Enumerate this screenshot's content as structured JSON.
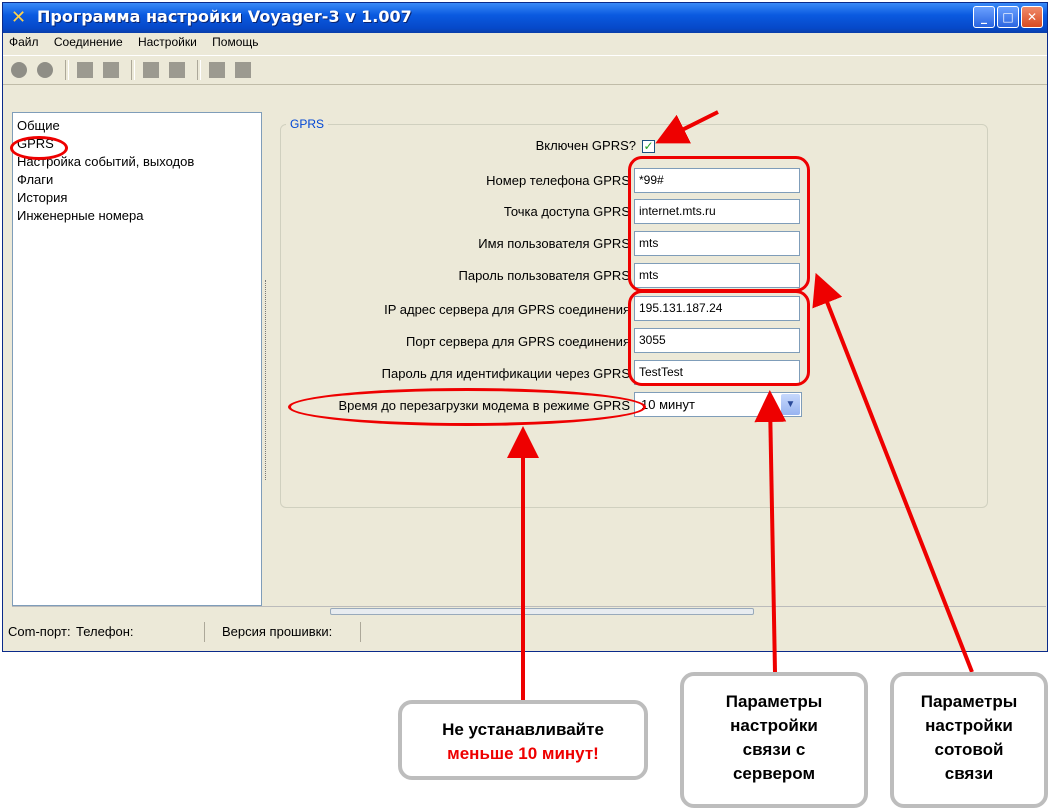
{
  "window": {
    "title": "Программа настройки Voyager-3 v 1.007",
    "app_icon": "tools-icon"
  },
  "menu": {
    "items": [
      "Файл",
      "Соединение",
      "Настройки",
      "Помощь"
    ]
  },
  "nav": {
    "items": [
      {
        "label": "Общие"
      },
      {
        "label": "GPRS",
        "selected": true
      },
      {
        "label": "Настройка событий, выходов"
      },
      {
        "label": "Флаги"
      },
      {
        "label": "История"
      },
      {
        "label": "Инженерные номера"
      }
    ]
  },
  "gprs": {
    "legend": "GPRS",
    "enabled_label": "Включен GPRS?",
    "enabled_checked": true,
    "phone_label": "Номер телефона GPRS",
    "phone_value": "*99#",
    "apn_label": "Точка доступа GPRS",
    "apn_value": "internet.mts.ru",
    "user_label": "Имя пользователя GPRS",
    "user_value": "mts",
    "pass_label": "Пароль пользователя GPRS",
    "pass_value": "mts",
    "server_ip_label": "IP адрес сервера для GPRS соединения",
    "server_ip_value": "195.131.187.24",
    "server_port_label": "Порт сервера для GPRS соединения",
    "server_port_value": "3055",
    "auth_pass_label": "Пароль для идентификации через GPRS",
    "auth_pass_value": "TestTest",
    "reboot_label": "Время до перезагрузки модема в режиме GPRS",
    "reboot_value": "10 минут"
  },
  "status": {
    "com_port": "Com-порт:",
    "phone": "Телефон:",
    "firmware": "Версия прошивки:"
  },
  "callouts": {
    "warning_line1": "Не устанавливайте",
    "warning_line2": "меньше 10 минут!",
    "server_line1": "Параметры",
    "server_line2": "настройки",
    "server_line3": "связи с",
    "server_line4": "сервером",
    "cell_line1": "Параметры",
    "cell_line2": "настройки",
    "cell_line3": "сотовой",
    "cell_line4": "связи"
  },
  "colors": {
    "annotation": "#e00000",
    "titlebar": "#0a5ae0"
  }
}
